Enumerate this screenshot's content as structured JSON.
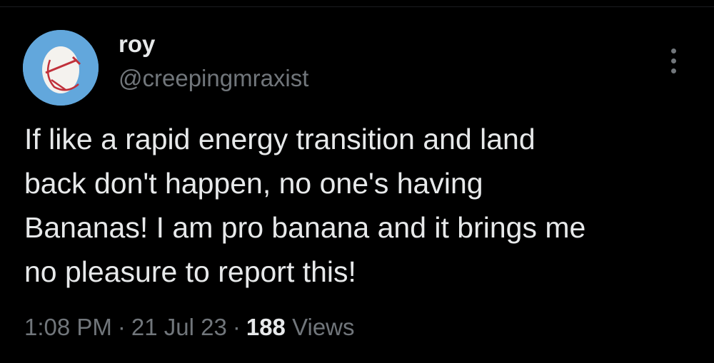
{
  "tweet": {
    "author": {
      "display_name": "roy",
      "handle": "@creepingmraxist",
      "avatar_icon": "egg-hammer-sickle-avatar",
      "avatar_bg": "#62a7dc"
    },
    "more_icon": "more-vertical-icon",
    "text": "If like a rapid energy transition and land\nback don't happen, no one's having\nBananas! I am pro banana and it brings me\nno pleasure to report this!",
    "time": "1:08 PM",
    "date": "21 Jul 23",
    "separator": "·",
    "views_count": "188",
    "views_label": "Views"
  },
  "colors": {
    "background": "#000000",
    "primary_text": "#e7e9ea",
    "secondary_text": "#71767b"
  }
}
